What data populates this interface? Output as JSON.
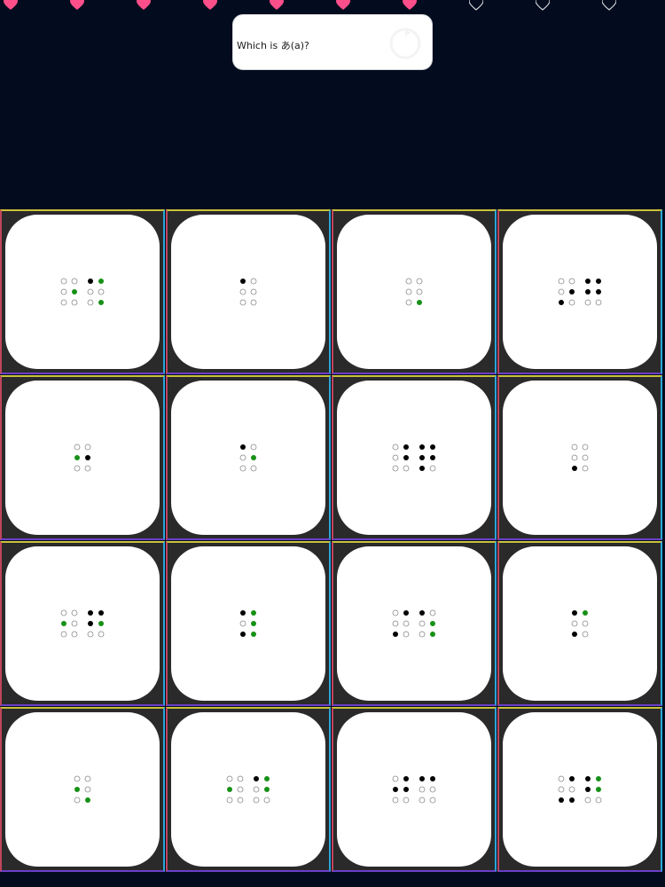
{
  "hearts": {
    "filled": 7,
    "total": 10,
    "filled_color": "#ff4f8b",
    "empty_color": "#d9dbe0"
  },
  "prompt": {
    "text": "Which is あ(a)?",
    "icon": "refresh-icon"
  },
  "colors": {
    "cell_border_top": "#c9c23a",
    "cell_border_left": "#c0455d",
    "cell_border_right": "#2aa7d9",
    "cell_border_bottom": "#6b3fc7",
    "dot_raised": "#000000",
    "dot_highlight": "#179117",
    "dot_empty_stroke": "#8a8a8a"
  },
  "cards": [
    {
      "cells": [
        [
          0,
          0,
          0,
          0,
          2,
          0
        ],
        [
          1,
          0,
          0,
          2,
          0,
          2
        ]
      ]
    },
    {
      "cells": [
        [
          1,
          0,
          0,
          0,
          0,
          0
        ]
      ]
    },
    {
      "cells": [
        [
          0,
          0,
          0,
          0,
          0,
          2
        ]
      ]
    },
    {
      "cells": [
        [
          0,
          0,
          1,
          0,
          1,
          0
        ],
        [
          1,
          1,
          0,
          1,
          1,
          0
        ]
      ]
    },
    {
      "cells": [
        [
          0,
          2,
          0,
          0,
          1,
          0
        ]
      ]
    },
    {
      "cells": [
        [
          1,
          0,
          0,
          0,
          2,
          0
        ]
      ]
    },
    {
      "cells": [
        [
          0,
          0,
          0,
          1,
          1,
          0
        ],
        [
          1,
          1,
          1,
          1,
          1,
          0
        ]
      ]
    },
    {
      "cells": [
        [
          0,
          0,
          1,
          0,
          0,
          0
        ]
      ]
    },
    {
      "cells": [
        [
          0,
          2,
          0,
          0,
          0,
          0
        ],
        [
          1,
          1,
          0,
          1,
          2,
          0
        ]
      ]
    },
    {
      "cells": [
        [
          1,
          0,
          1,
          2,
          2,
          2
        ]
      ]
    },
    {
      "cells": [
        [
          0,
          0,
          1,
          1,
          0,
          0
        ],
        [
          1,
          0,
          0,
          0,
          2,
          2
        ]
      ]
    },
    {
      "cells": [
        [
          1,
          0,
          1,
          2,
          0,
          0
        ]
      ]
    },
    {
      "cells": [
        [
          0,
          2,
          0,
          0,
          0,
          2
        ]
      ]
    },
    {
      "cells": [
        [
          0,
          2,
          0,
          0,
          0,
          0
        ],
        [
          1,
          0,
          0,
          2,
          2,
          0
        ]
      ]
    },
    {
      "cells": [
        [
          0,
          1,
          0,
          1,
          1,
          0
        ],
        [
          1,
          0,
          0,
          1,
          0,
          0
        ]
      ]
    },
    {
      "cells": [
        [
          0,
          0,
          1,
          1,
          0,
          1
        ],
        [
          1,
          1,
          0,
          2,
          2,
          0
        ]
      ]
    }
  ]
}
